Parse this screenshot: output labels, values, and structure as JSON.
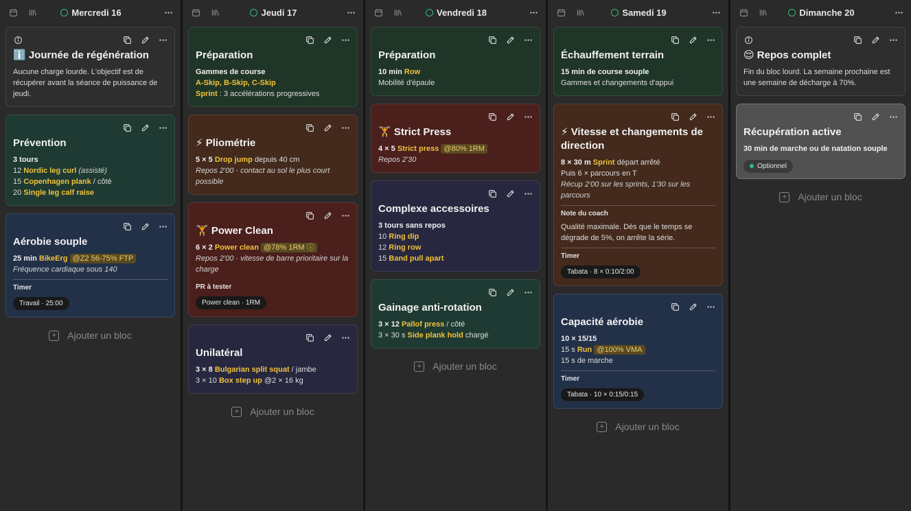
{
  "add_block_label": "Ajouter un bloc",
  "columns": [
    {
      "day": "Mercredi 16",
      "cards": [
        {
          "color": "dark",
          "info": true,
          "title": "ℹ️ Journée de régénération",
          "lines": [
            [
              {
                "t": "Aucune charge lourde. L'objectif est de récupérer avant la séance de puissance de jeudi."
              }
            ]
          ]
        },
        {
          "color": "teal",
          "title": "Prévention",
          "lines": [
            [
              {
                "t": "3 tours",
                "s": "b"
              }
            ],
            [
              {
                "t": "12 "
              },
              {
                "t": "Nordic leg curl",
                "s": "y"
              },
              {
                "t": " "
              },
              {
                "t": "(assisté)",
                "s": "it"
              }
            ],
            [
              {
                "t": "15 "
              },
              {
                "t": "Copenhagen plank",
                "s": "y"
              },
              {
                "t": " / côté"
              }
            ],
            [
              {
                "t": "20 "
              },
              {
                "t": "Single leg calf raise",
                "s": "y"
              }
            ]
          ]
        },
        {
          "color": "navy",
          "title": "Aérobie souple",
          "lines": [
            [
              {
                "t": "25 min ",
                "s": "b"
              },
              {
                "t": "BikeErg",
                "s": "y"
              },
              {
                "t": " "
              },
              {
                "t": "@Z2 56-75% FTP",
                "s": "tag"
              }
            ],
            [
              {
                "t": "Fréquence cardiaque sous 140",
                "s": "it"
              }
            ]
          ],
          "sections": [
            {
              "label": "Timer",
              "pill": "Travail · 25:00"
            }
          ]
        }
      ]
    },
    {
      "day": "Jeudi 17",
      "cards": [
        {
          "color": "green",
          "title": "Préparation",
          "lines": [
            [
              {
                "t": "Gammes de course",
                "s": "b"
              }
            ],
            [
              {
                "t": "A-Skip, B-Skip, C-Skip",
                "s": "y"
              }
            ],
            [
              {
                "t": "Sprint",
                "s": "y"
              },
              {
                "t": " : 3 accélérations progressives"
              }
            ]
          ]
        },
        {
          "color": "brown",
          "title": "⚡ Pliométrie",
          "lines": [
            [
              {
                "t": "5 × 5 ",
                "s": "b"
              },
              {
                "t": "Drop jump",
                "s": "y"
              },
              {
                "t": " depuis 40 cm"
              }
            ],
            [
              {
                "t": "Repos 2'00 · contact au sol le plus court possible",
                "s": "it"
              }
            ]
          ]
        },
        {
          "color": "red",
          "title": "🏋️ Power Clean",
          "lines": [
            [
              {
                "t": "6 × 2 ",
                "s": "b"
              },
              {
                "t": "Power clean",
                "s": "y"
              },
              {
                "t": " "
              },
              {
                "t": "@78% 1RM ⓘ",
                "s": "tag"
              }
            ],
            [
              {
                "t": "Repos 2'00 · vitesse de barre prioritaire sur la charge",
                "s": "it"
              }
            ]
          ],
          "sections": [
            {
              "label": "PR à tester",
              "pill": "Power clean · 1RM",
              "nosep": true
            }
          ]
        },
        {
          "color": "indigo",
          "title": "Unilatéral",
          "lines": [
            [
              {
                "t": "3 × 8 ",
                "s": "b"
              },
              {
                "t": "Bulgarian split squat",
                "s": "y"
              },
              {
                "t": " / jambe"
              }
            ],
            [
              {
                "t": "3 × 10 "
              },
              {
                "t": "Box step up",
                "s": "y"
              },
              {
                "t": " @2 × 16 kg"
              }
            ]
          ]
        }
      ]
    },
    {
      "day": "Vendredi 18",
      "cards": [
        {
          "color": "green",
          "title": "Préparation",
          "lines": [
            [
              {
                "t": "10 min ",
                "s": "b"
              },
              {
                "t": "Row",
                "s": "y"
              }
            ],
            [
              {
                "t": "Mobilité d'épaule"
              }
            ]
          ]
        },
        {
          "color": "red",
          "title": "🏋️ Strict Press",
          "lines": [
            [
              {
                "t": "4 × 5 ",
                "s": "b"
              },
              {
                "t": "Strict press",
                "s": "y"
              },
              {
                "t": " "
              },
              {
                "t": "@80% 1RM",
                "s": "tag"
              }
            ],
            [
              {
                "t": "Repos 2'30",
                "s": "it"
              }
            ]
          ]
        },
        {
          "color": "indigo",
          "title": "Complexe accessoires",
          "lines": [
            [
              {
                "t": "3 tours sans repos",
                "s": "b"
              }
            ],
            [
              {
                "t": "10 "
              },
              {
                "t": "Ring dip",
                "s": "y"
              }
            ],
            [
              {
                "t": "12 "
              },
              {
                "t": "Ring row",
                "s": "y"
              }
            ],
            [
              {
                "t": "15 "
              },
              {
                "t": "Band pull apart",
                "s": "y"
              }
            ]
          ]
        },
        {
          "color": "teal",
          "title": "Gainage anti-rotation",
          "lines": [
            [
              {
                "t": "3 × 12 ",
                "s": "b"
              },
              {
                "t": "Pallof press",
                "s": "y"
              },
              {
                "t": " / côté"
              }
            ],
            [
              {
                "t": "3 × 30 s "
              },
              {
                "t": "Side plank hold",
                "s": "y"
              },
              {
                "t": " chargé"
              }
            ]
          ]
        }
      ]
    },
    {
      "day": "Samedi 19",
      "cards": [
        {
          "color": "green",
          "title": "Échauffement terrain",
          "lines": [
            [
              {
                "t": "15 min de course souple",
                "s": "b"
              }
            ],
            [
              {
                "t": "Gammes et changements d'appui"
              }
            ]
          ]
        },
        {
          "color": "brown",
          "title": "⚡ Vitesse et changements de direction",
          "lines": [
            [
              {
                "t": "8 × 30 m ",
                "s": "b"
              },
              {
                "t": "Sprint",
                "s": "y"
              },
              {
                "t": " départ arrêté"
              }
            ],
            [
              {
                "t": "Puis 6 × parcours en T"
              }
            ],
            [
              {
                "t": "Récup 2'00 sur les sprints, 1'30 sur les parcours",
                "s": "it"
              }
            ]
          ],
          "sections": [
            {
              "label": "Note du coach",
              "text": "Qualité maximale. Dès que le temps se dégrade de 5%, on arrête la série."
            },
            {
              "label": "Timer",
              "pill": "Tabata · 8 × 0:10/2:00"
            }
          ]
        },
        {
          "color": "navy",
          "title": "Capacité aérobie",
          "lines": [
            [
              {
                "t": "10 × 15/15",
                "s": "b"
              }
            ],
            [
              {
                "t": "15 s "
              },
              {
                "t": "Run",
                "s": "y"
              },
              {
                "t": " "
              },
              {
                "t": "@100% VMA",
                "s": "tag"
              }
            ],
            [
              {
                "t": "15 s de marche"
              }
            ]
          ],
          "sections": [
            {
              "label": "Timer",
              "pill": "Tabata · 10 × 0:15/0:15"
            }
          ]
        }
      ]
    },
    {
      "day": "Dimanche 20",
      "cards": [
        {
          "color": "dark",
          "info": true,
          "title": "😌 Repos complet",
          "lines": [
            [
              {
                "t": "Fin du bloc lourd. La semaine prochaine est une semaine de décharge à 70%."
              }
            ]
          ]
        },
        {
          "color": "gray",
          "title": "Récupération active",
          "lines": [
            [
              {
                "t": "30 min de marche ou de natation souple",
                "s": "b"
              }
            ]
          ],
          "badge": "Optionnel"
        }
      ]
    }
  ]
}
